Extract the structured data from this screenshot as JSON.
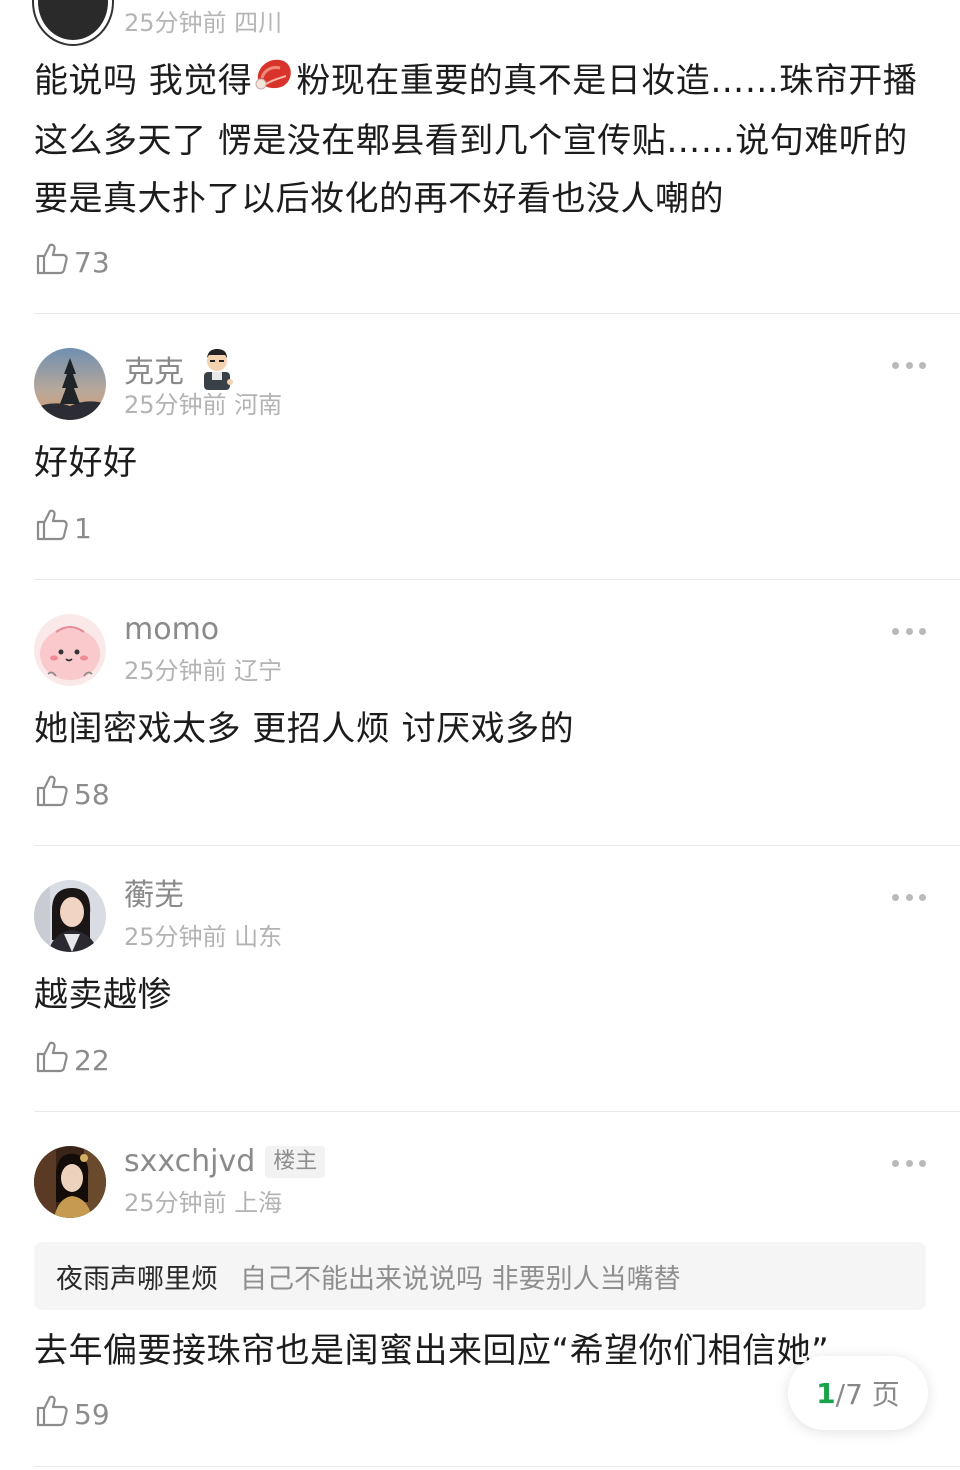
{
  "partial_comment": {
    "meta": "25分钟前 四川",
    "text_before_emoji": "能说吗 我觉得",
    "text_after_emoji": "粉现在重要的真不是日妆造……珠帘开播这么多天了 愣是没在郫县看到几个宣传贴……说句难听的 要是真大扑了以后妆化的再不好看也没人嘲的",
    "likes": "73"
  },
  "comments": [
    {
      "username": "克克",
      "meta": "25分钟前 河南",
      "text": "好好好",
      "likes": "1"
    },
    {
      "username": "momo",
      "meta": "25分钟前 辽宁",
      "text": "她闺密戏太多 更招人烦 讨厌戏多的",
      "likes": "58"
    },
    {
      "username": "蘅芜",
      "meta": "25分钟前 山东",
      "text": "越卖越惨",
      "likes": "22"
    },
    {
      "username": "sxxchjvd",
      "badge": "楼主",
      "meta": "25分钟前 上海",
      "quote_user": "夜雨声哪里烦",
      "quote_text": "自己不能出来说说吗 非要别人当嘴替",
      "text": "去年偏要接珠帘也是闺蜜出来回应“希望你们相信她”",
      "likes": "59"
    }
  ],
  "pagination": {
    "current": "1",
    "total_label": "/7 页"
  },
  "colors": {
    "accent": "#1aa34a",
    "text_gray": "#8a8a8a",
    "divider": "#e9e9e9"
  }
}
